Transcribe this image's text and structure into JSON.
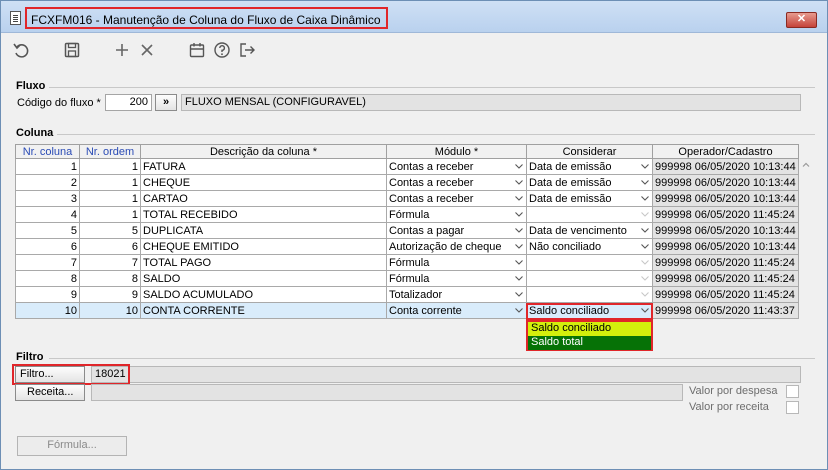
{
  "window": {
    "title": "FCXFM016 - Manutenção de Coluna do Fluxo de Caixa Dinâmico",
    "close_label": "✕"
  },
  "toolbar": {
    "icons": [
      "undo-icon",
      "save-icon",
      "add-icon",
      "delete-icon",
      "calendar-icon",
      "help-icon",
      "exit-icon"
    ]
  },
  "fluxo": {
    "group_label": "Fluxo",
    "code_label": "Código do fluxo *",
    "code_value": "200",
    "lookup_label": "»",
    "description": "FLUXO MENSAL (CONFIGURAVEL)"
  },
  "coluna": {
    "group_label": "Coluna",
    "headers": {
      "nr_coluna": "Nr. coluna",
      "nr_ordem": "Nr. ordem",
      "descricao": "Descrição da coluna *",
      "modulo": "Módulo *",
      "considerar": "Considerar",
      "operador": "Operador/Cadastro"
    },
    "rows": [
      {
        "nr_coluna": "1",
        "nr_ordem": "1",
        "descricao": "FATURA",
        "modulo": "Contas a receber",
        "considerar": "Data de emissão",
        "operador": "999998",
        "cadastro": "06/05/2020 10:13:44"
      },
      {
        "nr_coluna": "2",
        "nr_ordem": "1",
        "descricao": "CHEQUE",
        "modulo": "Contas a receber",
        "considerar": "Data de emissão",
        "operador": "999998",
        "cadastro": "06/05/2020 10:13:44"
      },
      {
        "nr_coluna": "3",
        "nr_ordem": "1",
        "descricao": "CARTAO",
        "modulo": "Contas a receber",
        "considerar": "Data de emissão",
        "operador": "999998",
        "cadastro": "06/05/2020 10:13:44"
      },
      {
        "nr_coluna": "4",
        "nr_ordem": "1",
        "descricao": "TOTAL RECEBIDO",
        "modulo": "Fórmula",
        "considerar": "",
        "operador": "999998",
        "cadastro": "06/05/2020 11:45:24"
      },
      {
        "nr_coluna": "5",
        "nr_ordem": "5",
        "descricao": "DUPLICATA",
        "modulo": "Contas a pagar",
        "considerar": "Data de vencimento",
        "operador": "999998",
        "cadastro": "06/05/2020 10:13:44"
      },
      {
        "nr_coluna": "6",
        "nr_ordem": "6",
        "descricao": "CHEQUE EMITIDO",
        "modulo": "Autorização de cheque",
        "considerar": "Não conciliado",
        "operador": "999998",
        "cadastro": "06/05/2020 10:13:44"
      },
      {
        "nr_coluna": "7",
        "nr_ordem": "7",
        "descricao": "TOTAL PAGO",
        "modulo": "Fórmula",
        "considerar": "",
        "operador": "999998",
        "cadastro": "06/05/2020 11:45:24"
      },
      {
        "nr_coluna": "8",
        "nr_ordem": "8",
        "descricao": "SALDO",
        "modulo": "Fórmula",
        "considerar": "",
        "operador": "999998",
        "cadastro": "06/05/2020 11:45:24"
      },
      {
        "nr_coluna": "9",
        "nr_ordem": "9",
        "descricao": "SALDO ACUMULADO",
        "modulo": "Totalizador",
        "considerar": "",
        "operador": "999998",
        "cadastro": "06/05/2020 11:45:24"
      },
      {
        "nr_coluna": "10",
        "nr_ordem": "10",
        "descricao": "CONTA CORRENTE",
        "modulo": "Conta corrente",
        "considerar": "Saldo conciliado",
        "operador": "999998",
        "cadastro": "06/05/2020 11:43:37"
      }
    ],
    "dropdown_options": [
      "Saldo conciliado",
      "Saldo total"
    ]
  },
  "filtro": {
    "group_label": "Filtro",
    "filtro_button": "Filtro...",
    "filtro_value": "18021",
    "receita_button": "Receita...",
    "receita_value": "",
    "valor_despesa_label": "Valor por despesa",
    "valor_receita_label": "Valor por receita",
    "formula_button": "Fórmula..."
  },
  "colors": {
    "highlight": "#e0262a",
    "dropdown_option_1": "#d3ef0c",
    "dropdown_option_2": "#067206",
    "header_blue": "#2a4bb5"
  }
}
